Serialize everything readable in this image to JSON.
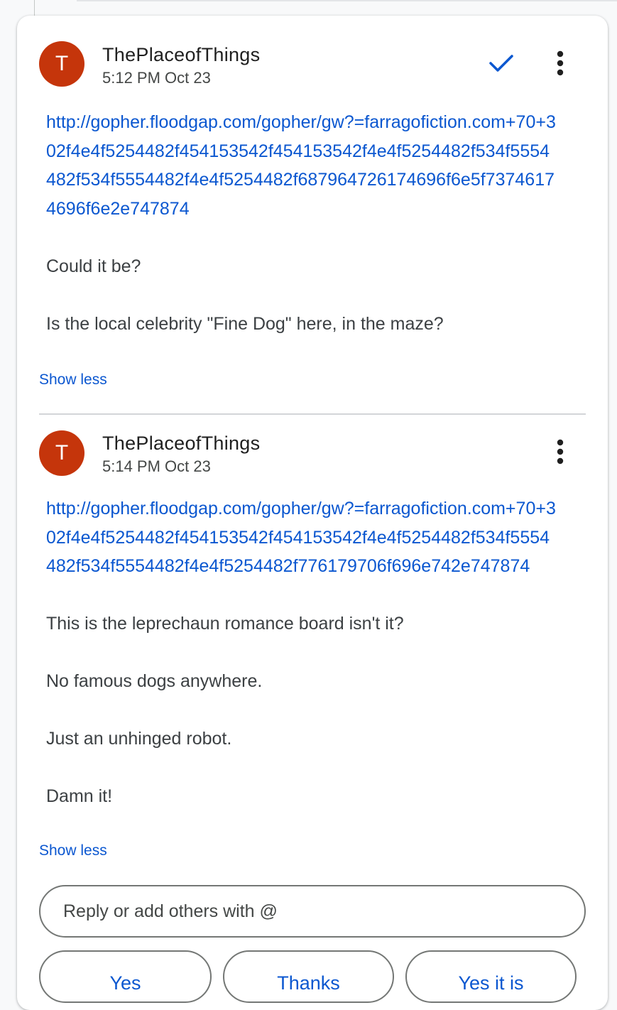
{
  "comments": [
    {
      "avatar_letter": "T",
      "author": "ThePlaceofThings",
      "time": "5:12 PM Oct 23",
      "resolved_icon": "check-icon",
      "link": "http://gopher.floodgap.com/gopher/gw?=farragofiction.com+70+302f4e4f5254482f454153542f454153542f4e4f5254482f534f5554482f534f5554482f4e4f5254482f687964726174696f6e5f73746174696f6e2e747874",
      "paragraphs": [
        "Could it be?",
        "Is the local celebrity \"Fine Dog\" here, in the maze?"
      ],
      "show_less": "Show less"
    },
    {
      "avatar_letter": "T",
      "author": "ThePlaceofThings",
      "time": "5:14 PM Oct 23",
      "link": "http://gopher.floodgap.com/gopher/gw?=farragofiction.com+70+302f4e4f5254482f454153542f454153542f4e4f5254482f534f5554482f534f5554482f4e4f5254482f776179706f696e742e747874",
      "paragraphs": [
        "This is the leprechaun romance board isn't it?",
        "No famous dogs anywhere.",
        "Just an unhinged robot.",
        "Damn it!"
      ],
      "show_less": "Show less"
    }
  ],
  "reply": {
    "placeholder": "Reply or add others with @"
  },
  "suggestions": [
    "Yes",
    "Thanks",
    "Yes it is"
  ],
  "colors": {
    "avatar": "#c5350b",
    "link": "#0b57d0",
    "text": "#3c4043"
  }
}
